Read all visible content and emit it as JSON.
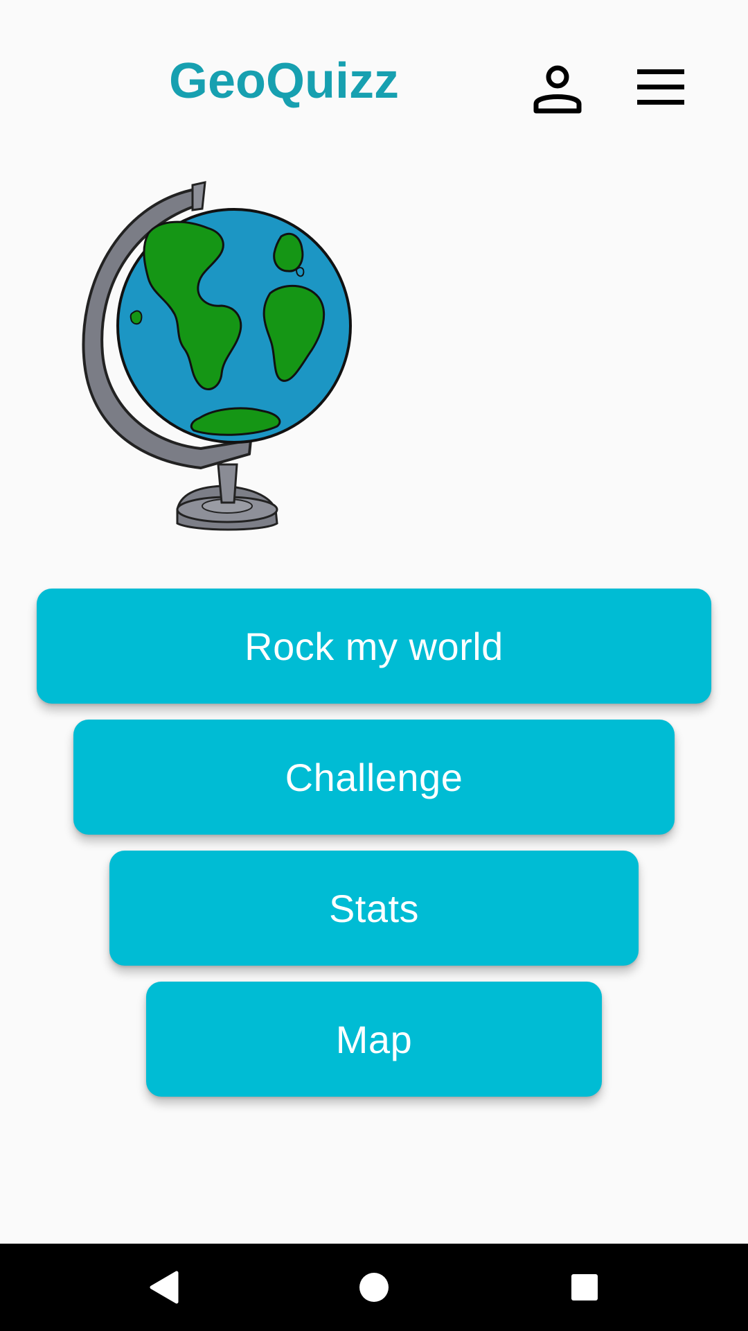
{
  "app": {
    "title": "GeoQuizz"
  },
  "header": {
    "profile_icon": "person-icon",
    "menu_icon": "hamburger-menu-icon"
  },
  "illustration": {
    "name": "globe-illustration"
  },
  "menu": {
    "buttons": [
      {
        "label": "Rock my world"
      },
      {
        "label": "Challenge"
      },
      {
        "label": "Stats"
      },
      {
        "label": "Map"
      }
    ]
  },
  "navigation_bar": {
    "back_icon": "back-triangle-icon",
    "home_icon": "home-circle-icon",
    "recents_icon": "recents-square-icon"
  },
  "colors": {
    "accent": "#00bcd4",
    "title": "#17a0b0",
    "background": "#fafafa",
    "nav_bar": "#000000"
  }
}
